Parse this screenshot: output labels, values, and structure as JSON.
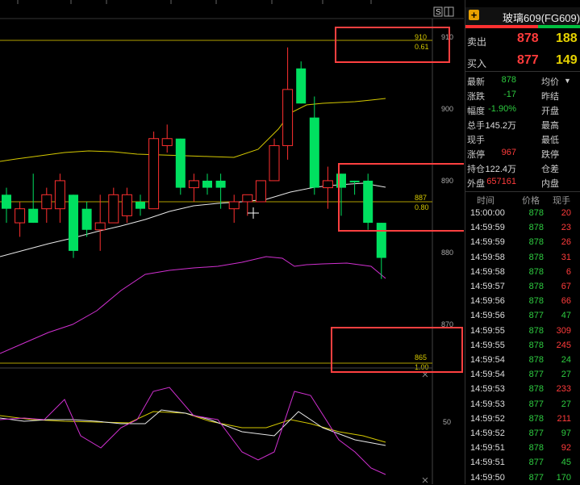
{
  "chart": {
    "price_labels": [
      "910",
      "900",
      "890",
      "880",
      "870",
      "50"
    ],
    "fib_labels": [
      {
        "price": "910",
        "ratio": "0.61"
      },
      {
        "price": "887",
        "ratio": "0.80"
      },
      {
        "price": "865",
        "ratio": "1.00"
      }
    ],
    "top_icon_label": "S",
    "colors": {
      "up": "#ff3030",
      "down": "#00e060",
      "ma_yellow": "#d4c800",
      "ma_white": "#e8e8e8",
      "ma_magenta": "#d030d0",
      "highlight": "#ff4040"
    }
  },
  "chart_data": {
    "type": "candlestick",
    "ylim": [
      868,
      912
    ],
    "candles": [
      {
        "o": 888,
        "h": 889,
        "l": 884,
        "c": 886,
        "dir": "down"
      },
      {
        "o": 884,
        "h": 887,
        "l": 882,
        "c": 886,
        "dir": "up"
      },
      {
        "o": 886,
        "h": 891,
        "l": 884,
        "c": 884,
        "dir": "down"
      },
      {
        "o": 886,
        "h": 889,
        "l": 884,
        "c": 888,
        "dir": "up"
      },
      {
        "o": 886,
        "h": 891,
        "l": 884,
        "c": 890,
        "dir": "up"
      },
      {
        "o": 888,
        "h": 888,
        "l": 879,
        "c": 880,
        "dir": "down"
      },
      {
        "o": 886,
        "h": 887,
        "l": 882,
        "c": 883,
        "dir": "down"
      },
      {
        "o": 883,
        "h": 888,
        "l": 880,
        "c": 884,
        "dir": "up"
      },
      {
        "o": 884,
        "h": 889,
        "l": 884,
        "c": 888,
        "dir": "up"
      },
      {
        "o": 888,
        "h": 889,
        "l": 884,
        "c": 885,
        "dir": "up"
      },
      {
        "o": 887,
        "h": 888,
        "l": 885,
        "c": 886,
        "dir": "down"
      },
      {
        "o": 886,
        "h": 897,
        "l": 886,
        "c": 896,
        "dir": "up"
      },
      {
        "o": 895,
        "h": 898,
        "l": 894,
        "c": 896,
        "dir": "up"
      },
      {
        "o": 896,
        "h": 896,
        "l": 888,
        "c": 889,
        "dir": "down"
      },
      {
        "o": 889,
        "h": 891,
        "l": 887,
        "c": 890,
        "dir": "up"
      },
      {
        "o": 890,
        "h": 891,
        "l": 888,
        "c": 889,
        "dir": "down"
      },
      {
        "o": 890,
        "h": 891,
        "l": 886,
        "c": 889,
        "dir": "down"
      },
      {
        "o": 886,
        "h": 888,
        "l": 884,
        "c": 887,
        "dir": "up"
      },
      {
        "o": 888,
        "h": 888,
        "l": 885,
        "c": 887,
        "dir": "up"
      },
      {
        "o": 887,
        "h": 890,
        "l": 887,
        "c": 890,
        "dir": "up"
      },
      {
        "o": 890,
        "h": 896,
        "l": 890,
        "c": 895,
        "dir": "up"
      },
      {
        "o": 895,
        "h": 909,
        "l": 893,
        "c": 903,
        "dir": "up"
      },
      {
        "o": 906,
        "h": 907,
        "l": 901,
        "c": 901,
        "dir": "down"
      },
      {
        "o": 899,
        "h": 902,
        "l": 888,
        "c": 889,
        "dir": "down"
      },
      {
        "o": 889,
        "h": 892,
        "l": 886,
        "c": 890,
        "dir": "up"
      },
      {
        "o": 891,
        "h": 891,
        "l": 885,
        "c": 889,
        "dir": "down"
      },
      {
        "o": 890,
        "h": 890,
        "l": 888,
        "c": 890,
        "dir": "down"
      },
      {
        "o": 890,
        "h": 891,
        "l": 883,
        "c": 884,
        "dir": "down"
      },
      {
        "o": 884,
        "h": 884,
        "l": 876,
        "c": 879,
        "dir": "down"
      }
    ]
  },
  "quote": {
    "title": "玻璃609(FG609)",
    "sell_label": "卖出",
    "sell_price": "878",
    "sell_vol": "188",
    "buy_label": "买入",
    "buy_price": "877",
    "buy_vol": "149"
  },
  "stats": [
    {
      "l1": "最新",
      "v1": "878",
      "c1": "green",
      "l2": "均价",
      "arrow": "▼"
    },
    {
      "l1": "涨跌",
      "v1": "-17",
      "c1": "green",
      "l2": "昨结"
    },
    {
      "l1": "幅度",
      "v1": "-1.90%",
      "c1": "green",
      "l2": "开盘"
    },
    {
      "l1": "总手",
      "v1": "145.2万",
      "c1": "white",
      "l2": "最高"
    },
    {
      "l1": "现手",
      "v1": "",
      "c1": "white",
      "l2": "最低"
    },
    {
      "l1": "涨停",
      "v1": "967",
      "c1": "red",
      "l2": "跌停"
    },
    {
      "l1": "持仓",
      "v1": "122.4万",
      "c1": "white",
      "l2": "仓差"
    },
    {
      "l1": "外盘",
      "v1": "657161",
      "c1": "red",
      "l2": "内盘"
    }
  ],
  "ticks_header": {
    "time": "时间",
    "price": "价格",
    "vol": "现手"
  },
  "ticks": [
    {
      "t": "15:00:00",
      "p": "878",
      "v": "20",
      "vc": "red"
    },
    {
      "t": "14:59:59",
      "p": "878",
      "v": "23",
      "vc": "red"
    },
    {
      "t": "14:59:59",
      "p": "878",
      "v": "26",
      "vc": "red"
    },
    {
      "t": "14:59:58",
      "p": "878",
      "v": "31",
      "vc": "red"
    },
    {
      "t": "14:59:58",
      "p": "878",
      "v": "6",
      "vc": "red"
    },
    {
      "t": "14:59:57",
      "p": "878",
      "v": "67",
      "vc": "red"
    },
    {
      "t": "14:59:56",
      "p": "878",
      "v": "66",
      "vc": "red"
    },
    {
      "t": "14:59:56",
      "p": "877",
      "v": "47",
      "vc": "green"
    },
    {
      "t": "14:59:55",
      "p": "878",
      "v": "309",
      "vc": "red"
    },
    {
      "t": "14:59:55",
      "p": "878",
      "v": "245",
      "vc": "red"
    },
    {
      "t": "14:59:54",
      "p": "878",
      "v": "24",
      "vc": "green"
    },
    {
      "t": "14:59:54",
      "p": "877",
      "v": "27",
      "vc": "green"
    },
    {
      "t": "14:59:53",
      "p": "878",
      "v": "233",
      "vc": "red"
    },
    {
      "t": "14:59:53",
      "p": "877",
      "v": "27",
      "vc": "green"
    },
    {
      "t": "14:59:52",
      "p": "878",
      "v": "211",
      "vc": "red"
    },
    {
      "t": "14:59:52",
      "p": "877",
      "v": "97",
      "vc": "green"
    },
    {
      "t": "14:59:51",
      "p": "878",
      "v": "92",
      "vc": "red"
    },
    {
      "t": "14:59:51",
      "p": "877",
      "v": "45",
      "vc": "green"
    },
    {
      "t": "14:59:50",
      "p": "877",
      "v": "170",
      "vc": "green"
    }
  ]
}
